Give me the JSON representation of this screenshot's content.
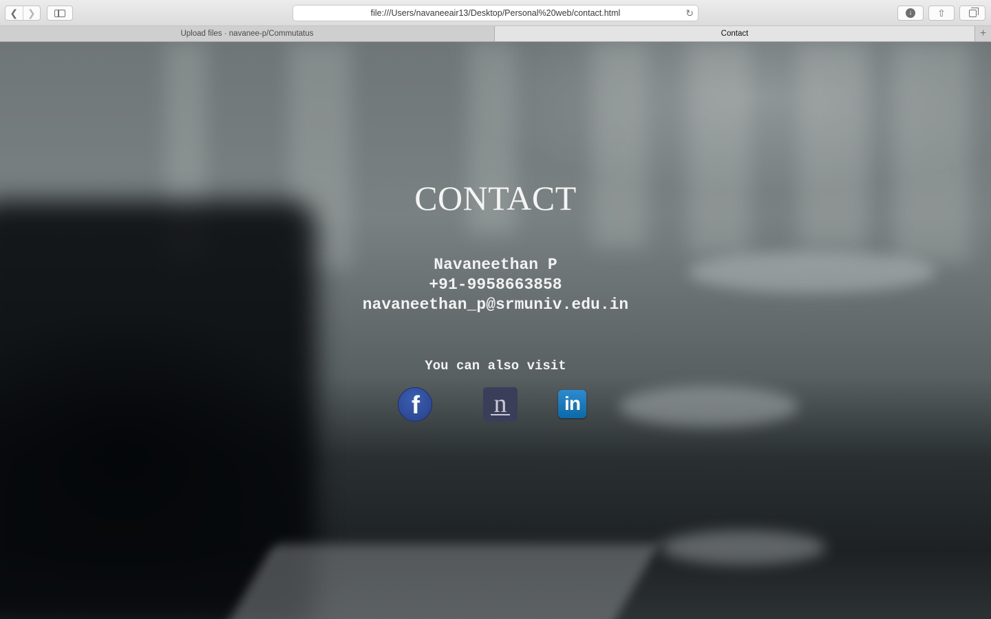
{
  "browser": {
    "url": "file:///Users/navaneeair13/Desktop/Personal%20web/contact.html",
    "tabs": [
      {
        "label": "Upload files · navanee-p/Commutatus",
        "active": false
      },
      {
        "label": "Contact",
        "active": true
      }
    ],
    "icons": {
      "back": "chevron-left-icon",
      "forward": "chevron-right-icon",
      "sidebar": "sidebar-icon",
      "reload": "reload-icon",
      "download": "download-icon",
      "share": "share-icon",
      "tabs": "tabs-overview-icon",
      "new_tab": "plus-icon"
    }
  },
  "page": {
    "title": "CONTACT",
    "name": "Navaneethan P",
    "phone": "+91-9958663858",
    "email": "navaneethan_p@srmuniv.edu.in",
    "visit_label": "You can also visit",
    "social": [
      {
        "name": "facebook",
        "glyph": "f",
        "color": "#2f4d9e"
      },
      {
        "name": "newsweaver",
        "glyph": "n",
        "color": "#3a3e58"
      },
      {
        "name": "linkedin",
        "glyph": "in",
        "color": "#1b7bc0"
      }
    ]
  }
}
